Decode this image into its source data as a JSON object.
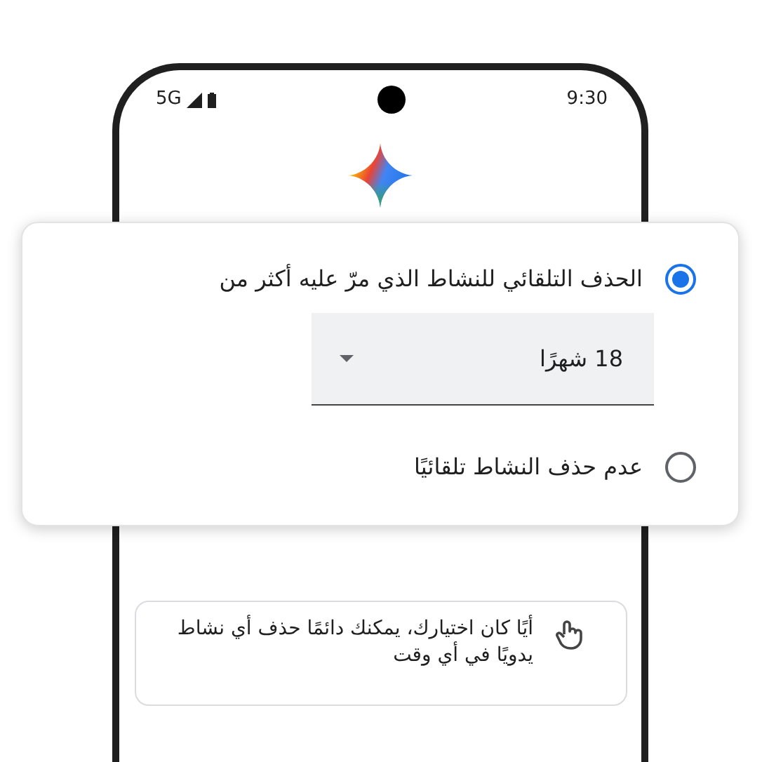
{
  "status_bar": {
    "network": "5G",
    "time": "9:30"
  },
  "options": [
    {
      "label": "الحذف التلقائي للنشاط الذي مرّ عليه أكثر من",
      "selected": true,
      "dropdown": {
        "value": "18 شهرًا"
      }
    },
    {
      "label": "عدم حذف النشاط تلقائيًا",
      "selected": false
    }
  ],
  "note": {
    "text": "أيًا كان اختيارك، يمكنك دائمًا حذف أي نشاط يدويًا في أي وقت"
  }
}
